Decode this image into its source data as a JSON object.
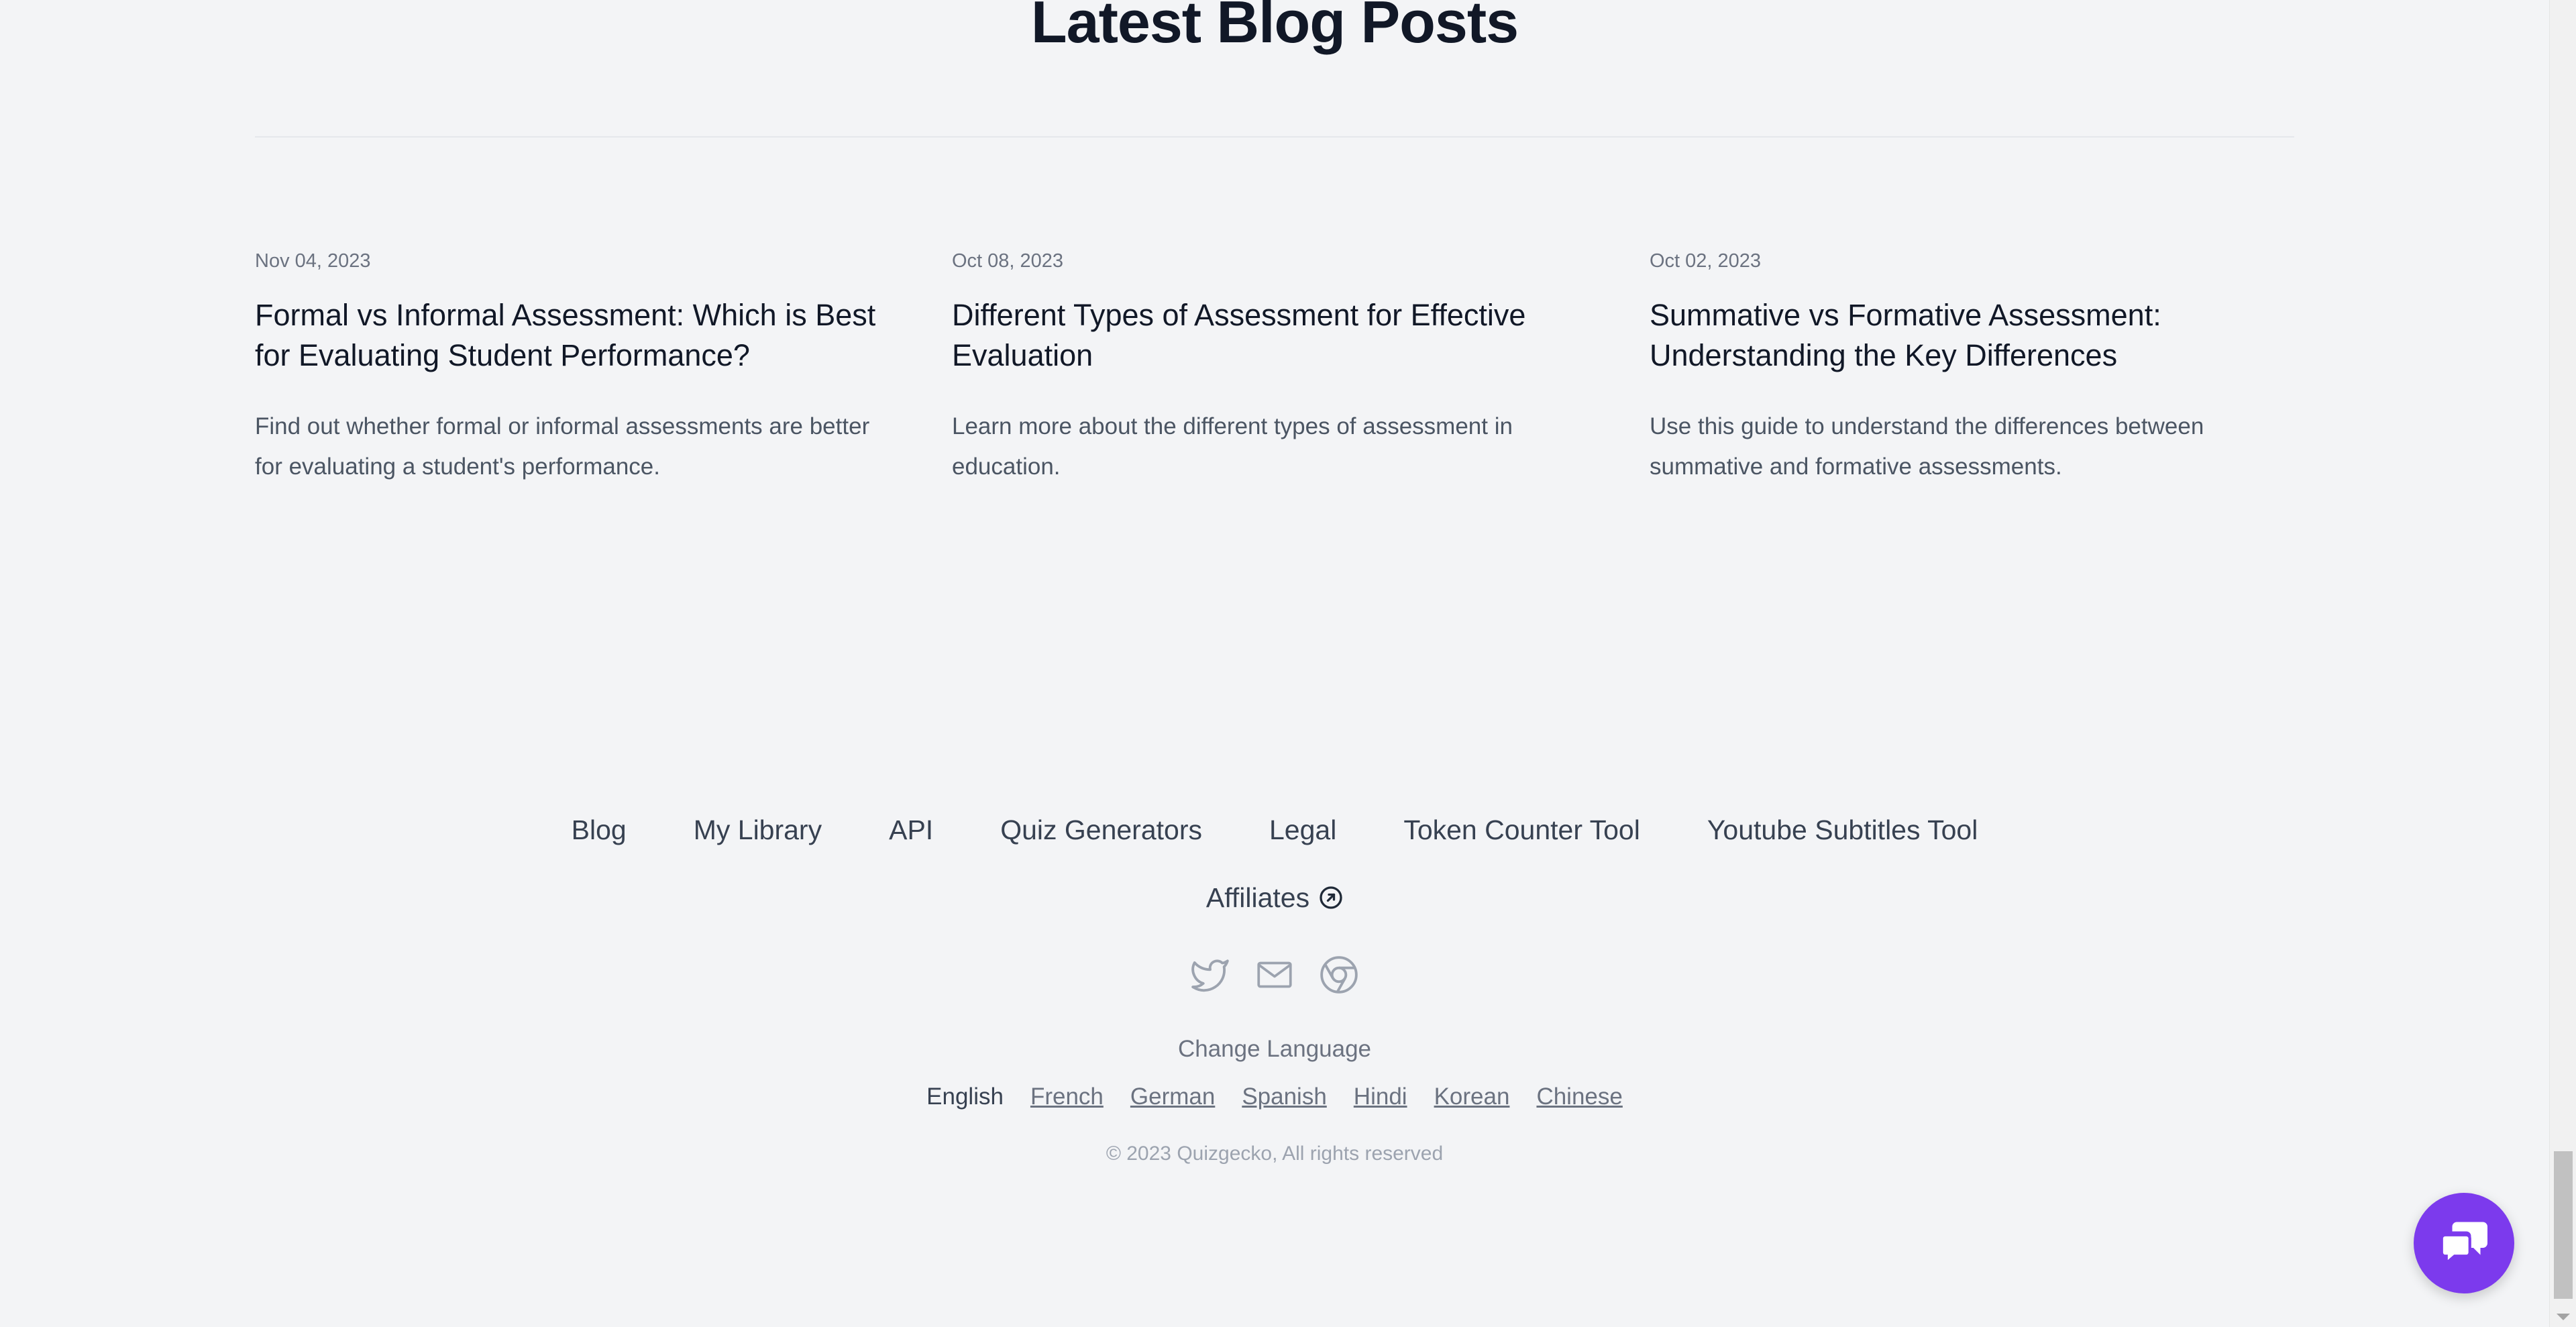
{
  "section": {
    "title": "Latest Blog Posts"
  },
  "posts": [
    {
      "date": "Nov 04, 2023",
      "title": "Formal vs Informal Assessment: Which is Best for Evaluating Student Performance?",
      "excerpt": "Find out whether formal or informal assessments are better for evaluating a student's performance."
    },
    {
      "date": "Oct 08, 2023",
      "title": "Different Types of Assessment for Effective Evaluation",
      "excerpt": "Learn more about the different types of assessment in education."
    },
    {
      "date": "Oct 02, 2023",
      "title": "Summative vs Formative Assessment: Understanding the Key Differences",
      "excerpt": "Use this guide to understand the differences between summative and formative assessments."
    }
  ],
  "footer": {
    "links": [
      "Blog",
      "My Library",
      "API",
      "Quiz Generators",
      "Legal",
      "Token Counter Tool",
      "Youtube Subtitles Tool"
    ],
    "affiliates": "Affiliates",
    "socials": [
      "twitter-icon",
      "mail-icon",
      "chrome-icon"
    ],
    "change_language": "Change Language",
    "languages": {
      "current": "English",
      "others": [
        "French",
        "German",
        "Spanish",
        "Hindi",
        "Korean",
        "Chinese"
      ]
    },
    "copyright": "© 2023 Quizgecko, All rights reserved"
  },
  "colors": {
    "background": "#f3f4f6",
    "chat_button": "#7c3aed",
    "text_primary": "#111827",
    "text_muted": "#6b7280"
  }
}
